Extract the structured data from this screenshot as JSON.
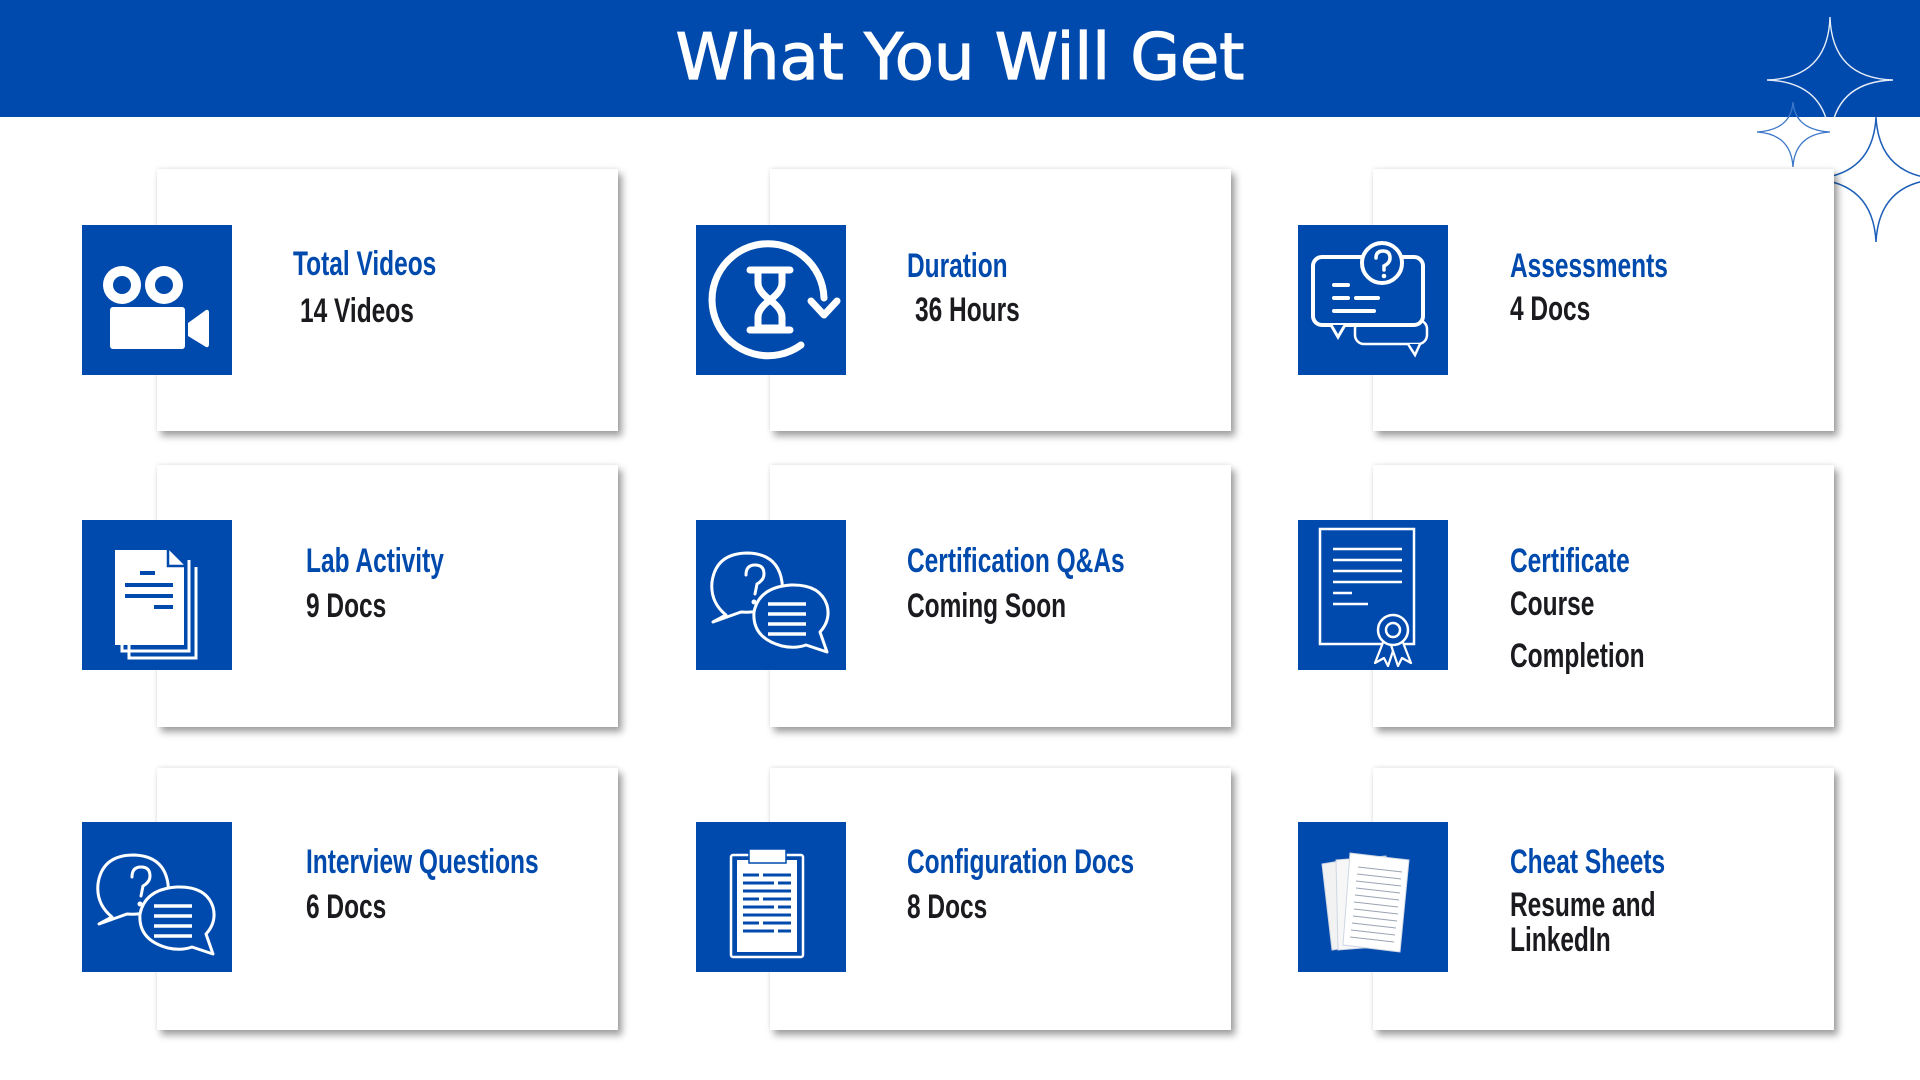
{
  "header": {
    "title": "What You Will Get",
    "background_color": "#004AAD",
    "decoration": "sparkle-stars"
  },
  "colors": {
    "accent": "#004AAD",
    "title_text": "#004AAD",
    "value_text": "#1B1B1F",
    "card_background": "#FFFFFF"
  },
  "cards": [
    {
      "icon": "video-camera-icon",
      "title": "Total Videos",
      "lines": [
        "14 Videos"
      ]
    },
    {
      "icon": "hourglass-refresh-icon",
      "title": "Duration",
      "lines": [
        "36 Hours"
      ]
    },
    {
      "icon": "question-chat-icon",
      "title": "Assessments",
      "lines": [
        "4 Docs"
      ]
    },
    {
      "icon": "documents-stack-icon",
      "title": "Lab Activity",
      "lines": [
        "9 Docs"
      ]
    },
    {
      "icon": "qa-bubbles-icon",
      "title": "Certification Q&As",
      "lines": [
        "Coming Soon"
      ]
    },
    {
      "icon": "certificate-icon",
      "title": "Certificate",
      "lines": [
        "Course",
        "Completion"
      ]
    },
    {
      "icon": "qa-bubbles-icon",
      "title": "Interview Questions",
      "lines": [
        "6 Docs"
      ]
    },
    {
      "icon": "clipboard-icon",
      "title": "Configuration Docs",
      "lines": [
        "8 Docs"
      ]
    },
    {
      "icon": "papers-icon",
      "title": "Cheat Sheets",
      "lines": [
        "Resume and",
        "LinkedIn"
      ]
    }
  ]
}
